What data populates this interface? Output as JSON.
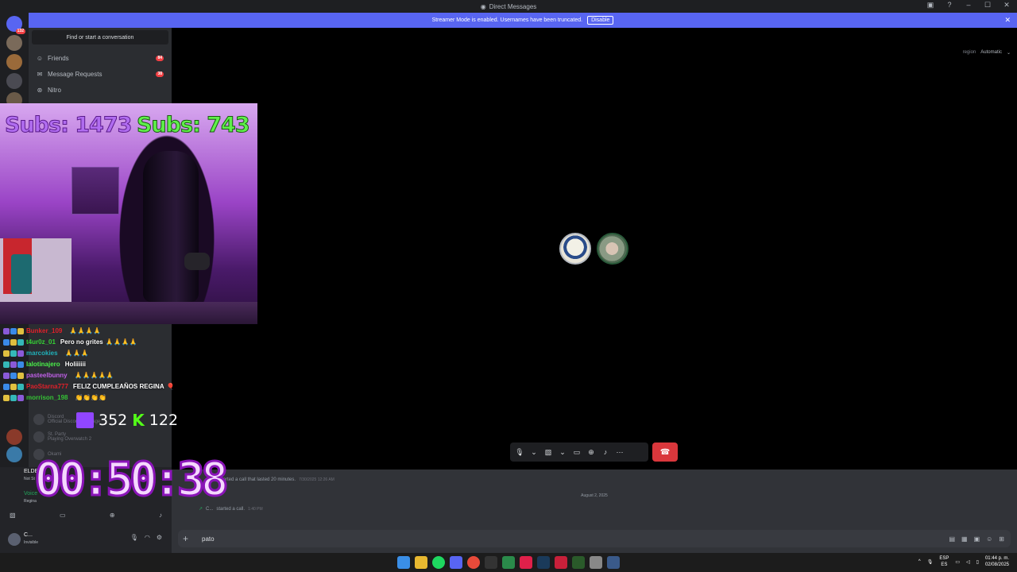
{
  "window": {
    "title": "Direct Messages",
    "controls": [
      "–",
      "☐",
      "✕"
    ]
  },
  "banner": {
    "text": "Streamer Mode is enabled. Usernames have been truncated.",
    "disable_label": "Disable",
    "close": "✕"
  },
  "rail": {
    "home_badge": "132"
  },
  "sidebar": {
    "find": "Find or start a conversation",
    "friends": "Friends",
    "friends_count": "84",
    "requests": "Message Requests",
    "requests_count": "38",
    "nitro": "Nitro",
    "dm_entries": [
      {
        "name": "Discord",
        "sub": "Official Discord Message"
      },
      {
        "name": "St. Party",
        "sub": "Playing Overwatch 2"
      },
      {
        "name": "Okami",
        "sub": ""
      }
    ]
  },
  "voice_panel": {
    "activity": "ELDEN",
    "activity_sub": "Not St",
    "voice": "Voice",
    "voice_sub": "Regina"
  },
  "user": {
    "name": "C...",
    "status": "Invisible"
  },
  "call": {
    "region_label": "region",
    "region_value": "Automatic"
  },
  "messages": {
    "line1": "started a call that lasted 20 minutes.",
    "line1_time": "7/30/2025 12:26 AM",
    "date": "August 2, 2025",
    "line2_user": "C...",
    "line2": "started a call.",
    "line2_time": "1:40 PM"
  },
  "composer": {
    "value": "pato"
  },
  "overlay": {
    "subs_left": "Subs: 1473",
    "subs_right": "Subs: 743",
    "twitch_count": "352",
    "kick_count": "122",
    "timer": "00:50:38",
    "chat": [
      {
        "user": "Bunker_109",
        "color": "#e0202a",
        "msg": "",
        "emotes": "🙏🙏🙏🙏"
      },
      {
        "user": "t4ur0z_01",
        "color": "#35d235",
        "msg": "Pero no grites",
        "emotes": "🙏🙏🙏🙏"
      },
      {
        "user": "marcokies",
        "color": "#20b0b8",
        "msg": "",
        "emotes": "🙏🙏🙏"
      },
      {
        "user": "lalotinajero",
        "color": "#4af04a",
        "msg": "Holiiiiii",
        "emotes": ""
      },
      {
        "user": "pasteelbunny",
        "color": "#c060e8",
        "msg": "",
        "emotes": "🙏🙏🙏🙏🙏"
      },
      {
        "user": "PaoStarna777",
        "color": "#e0202a",
        "msg": "FELIZ CUMPLEAÑOS REGINA",
        "emotes": "🎈"
      },
      {
        "user": "morrison_198",
        "color": "#35c235",
        "msg": "",
        "emotes": "👏👏👏👏"
      }
    ]
  },
  "taskbar": {
    "lang_top": "ESP",
    "lang_bottom": "ES",
    "time": "01:44 p. m.",
    "date": "02/08/2025"
  },
  "colors": {
    "blurple": "#5865f2",
    "hangup": "#da373c",
    "kick": "#53fc18",
    "twitch": "#9146ff"
  }
}
